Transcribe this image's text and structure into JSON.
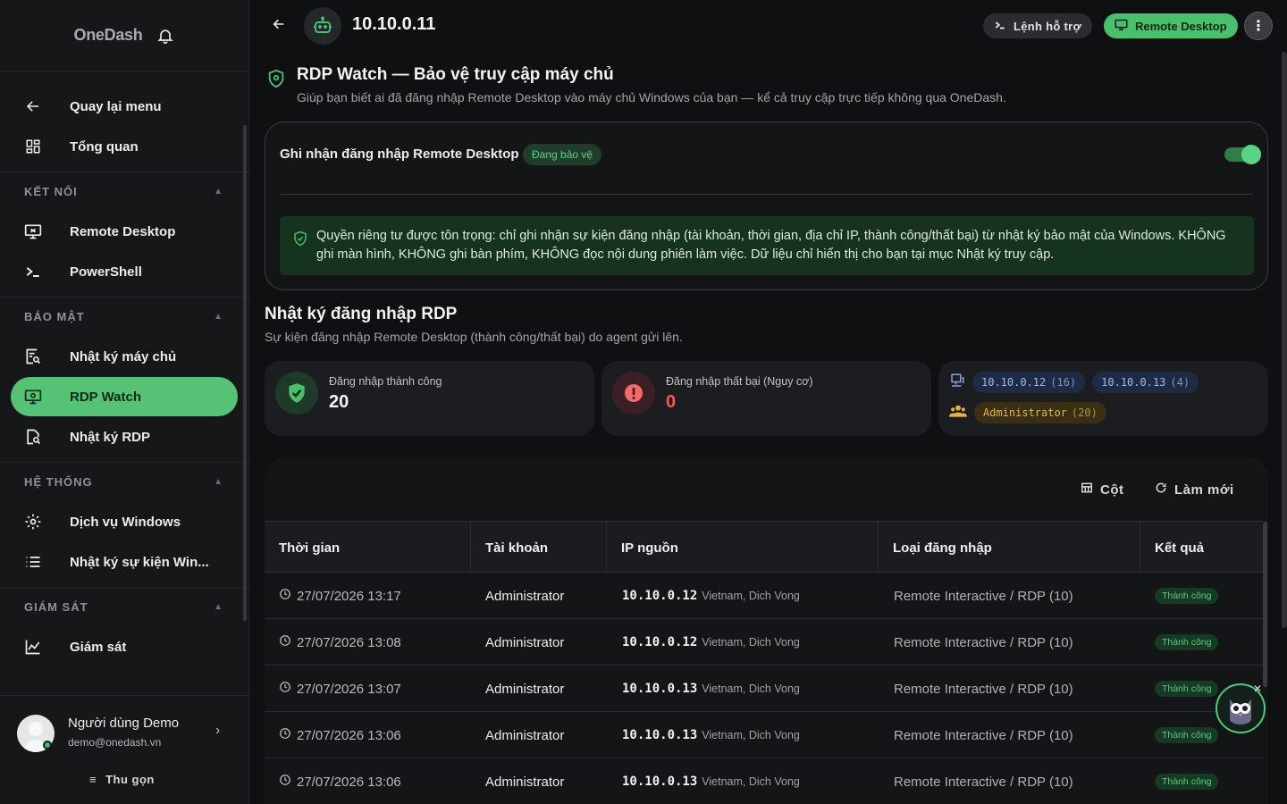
{
  "brand": {
    "name": "OneDash",
    "notify_icon": "bell-icon"
  },
  "sidebar": {
    "top_items": [
      {
        "label": "Quay lại menu",
        "icon": "arrow-left-icon"
      },
      {
        "label": "Tổng quan",
        "icon": "dashboard-icon"
      }
    ],
    "sections": [
      {
        "title": "KẾT NỐI",
        "items": [
          {
            "label": "Remote Desktop",
            "icon": "remote-desktop-icon"
          },
          {
            "label": "PowerShell",
            "icon": "terminal-icon"
          }
        ]
      },
      {
        "title": "BẢO MẬT",
        "items": [
          {
            "label": "Nhật ký máy chủ",
            "icon": "server-log-icon"
          },
          {
            "label": "RDP Watch",
            "icon": "rdp-watch-icon",
            "active": true
          },
          {
            "label": "Nhật ký RDP",
            "icon": "rdp-log-icon"
          }
        ]
      },
      {
        "title": "HỆ THỐNG",
        "items": [
          {
            "label": "Dịch vụ Windows",
            "icon": "gear-icon"
          },
          {
            "label": "Nhật ký sự kiện Win...",
            "icon": "list-icon"
          }
        ]
      },
      {
        "title": "GIÁM SÁT",
        "items": [
          {
            "label": "Giám sát",
            "icon": "chart-line-icon"
          }
        ]
      }
    ],
    "user": {
      "name": "Người dùng Demo",
      "email": "demo@onedash.vn"
    },
    "collapse_label": "Thu gọn"
  },
  "topbar": {
    "host": "10.10.0.11",
    "cmd_label": "Lệnh hỗ trợ",
    "rdp_label": "Remote Desktop"
  },
  "page": {
    "title": "RDP Watch — Bảo vệ truy cập máy chủ",
    "subtitle": "Giúp bạn biết ai đã đăng nhập Remote Desktop vào máy chủ Windows của bạn — kể cả truy cập trực tiếp không qua OneDash."
  },
  "protection": {
    "title": "Ghi nhận đăng nhập Remote Desktop",
    "badge": "Đang bảo vệ",
    "enabled": true,
    "privacy_text": "Quyền riêng tư được tôn trọng: chỉ ghi nhận sự kiện đăng nhập (tài khoản, thời gian, địa chỉ IP, thành công/thất bại) từ nhật ký bảo mật của Windows. KHÔNG ghi màn hình, KHÔNG ghi bàn phím, KHÔNG đọc nội dung phiên làm việc. Dữ liệu chỉ hiển thị cho bạn tại mục Nhật ký truy cập."
  },
  "log": {
    "title": "Nhật ký đăng nhập RDP",
    "subtitle": "Sự kiện đăng nhập Remote Desktop (thành công/thất bại) do agent gửi lên."
  },
  "stats": {
    "success_label": "Đăng nhập thành công",
    "success_value": "20",
    "fail_label": "Đăng nhập thất bại (Nguy cơ)",
    "fail_value": "0",
    "ips": [
      {
        "ip": "10.10.0.12",
        "count": "(16)"
      },
      {
        "ip": "10.10.0.13",
        "count": "(4)"
      }
    ],
    "accounts": [
      {
        "name": "Administrator",
        "count": "(20)"
      }
    ]
  },
  "table": {
    "columns_label": "Cột",
    "refresh_label": "Làm mới",
    "headers": [
      "Thời gian",
      "Tài khoản",
      "IP nguồn",
      "Loại đăng nhập",
      "Kết quả"
    ],
    "rows": [
      {
        "time": "27/07/2026 13:17",
        "account": "Administrator",
        "ip": "10.10.0.12",
        "loc": "Vietnam, Dich Vong",
        "type": "Remote Interactive / RDP (10)",
        "result": "Thành công"
      },
      {
        "time": "27/07/2026 13:08",
        "account": "Administrator",
        "ip": "10.10.0.12",
        "loc": "Vietnam, Dich Vong",
        "type": "Remote Interactive / RDP (10)",
        "result": "Thành công"
      },
      {
        "time": "27/07/2026 13:07",
        "account": "Administrator",
        "ip": "10.10.0.13",
        "loc": "Vietnam, Dich Vong",
        "type": "Remote Interactive / RDP (10)",
        "result": "Thành công"
      },
      {
        "time": "27/07/2026 13:06",
        "account": "Administrator",
        "ip": "10.10.0.13",
        "loc": "Vietnam, Dich Vong",
        "type": "Remote Interactive / RDP (10)",
        "result": "Thành công"
      },
      {
        "time": "27/07/2026 13:06",
        "account": "Administrator",
        "ip": "10.10.0.13",
        "loc": "Vietnam, Dich Vong",
        "type": "Remote Interactive / RDP (10)",
        "result": "Thành công"
      }
    ]
  },
  "colors": {
    "accent": "#4ac06d",
    "danger": "#f05a5a",
    "background": "#0f1012"
  }
}
